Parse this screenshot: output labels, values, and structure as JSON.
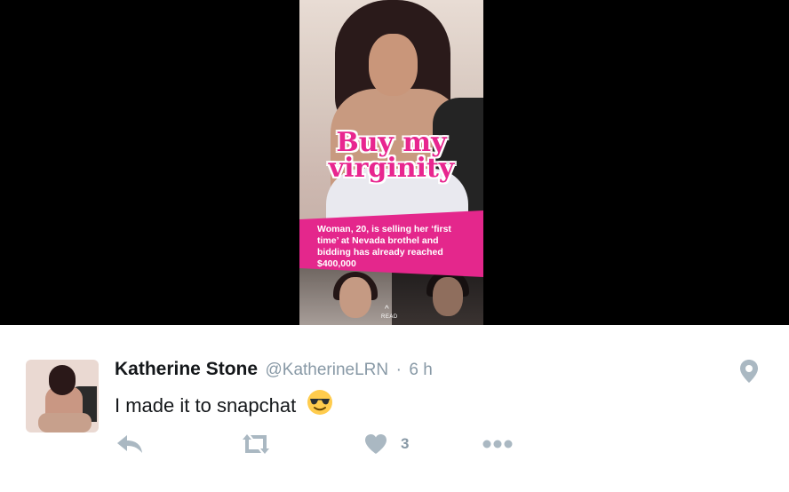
{
  "media": {
    "headline_line1": "Buy my",
    "headline_line2": "virginity",
    "banner_text": "Woman, 20, is selling her ‘first time’ at Nevada brothel and bidding has already reached $400,000",
    "read_label": "READ",
    "read_chevron": "^"
  },
  "tweet": {
    "name": "Katherine Stone",
    "handle": "@KatherineLRN",
    "separator": "·",
    "time": "6 h",
    "text": "I made it to snapchat",
    "emoji_icon": "sunglasses-face-icon",
    "like_count": "3"
  },
  "icons": {
    "location": "location-pin-icon",
    "reply": "reply-icon",
    "retweet": "retweet-icon",
    "like": "heart-icon",
    "more": "more-dots-icon"
  },
  "colors": {
    "accent_pink": "#e4278c",
    "icon_gray": "#aab8c2",
    "secondary_text": "#8899a6"
  }
}
